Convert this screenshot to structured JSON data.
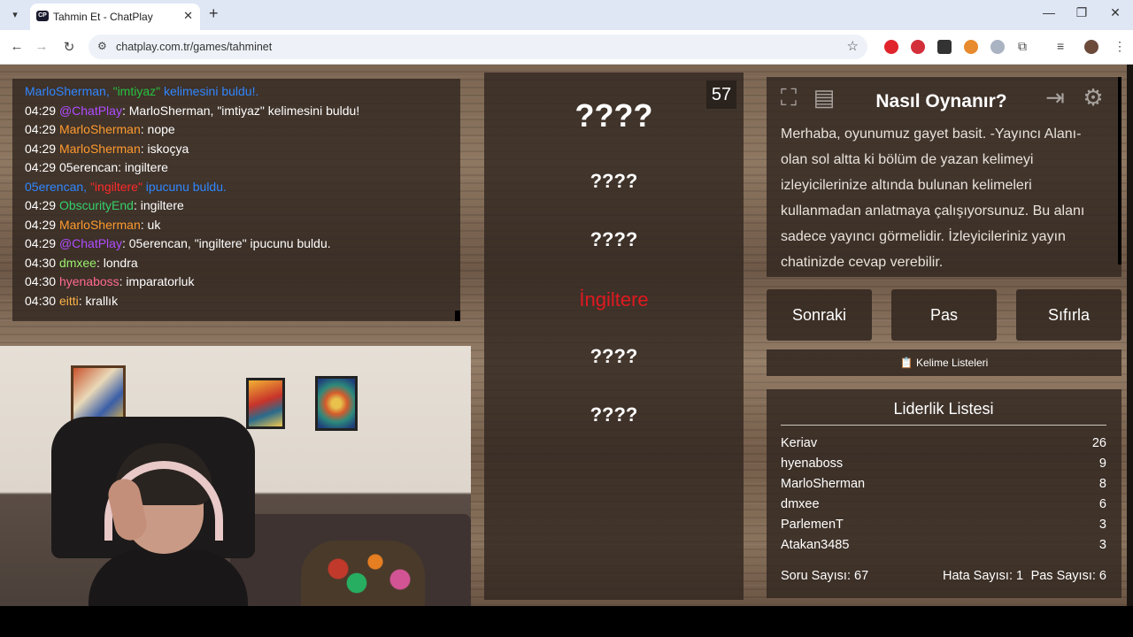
{
  "browser": {
    "tab_title": "Tahmin Et - ChatPlay",
    "url": "chatplay.com.tr/games/tahminet"
  },
  "chat": {
    "lines": [
      {
        "type": "sys",
        "text": "MarloSherman, \"imtiyaz\" kelimesini buldu!."
      },
      {
        "time": "04:29",
        "user": "@ChatPlay",
        "msg": ": MarloSherman, \"imtiyaz\" kelimesini buldu!"
      },
      {
        "time": "04:29",
        "user": "MarloSherman",
        "msg": ": nope"
      },
      {
        "time": "04:29",
        "user": "MarloSherman",
        "msg": ": iskoçya"
      },
      {
        "time": "04:29",
        "user": "05erencan",
        "msg": ": ingiltere"
      },
      {
        "type": "sys",
        "text": "05erencan, \"ingiltere\" ipucunu buldu."
      },
      {
        "time": "04:29",
        "user": "ObscurityEnd",
        "msg": ": ingiltere"
      },
      {
        "time": "04:29",
        "user": "MarloSherman",
        "msg": ": uk"
      },
      {
        "time": "04:29",
        "user": "@ChatPlay",
        "msg": ": 05erencan, \"ingiltere\" ipucunu buldu."
      },
      {
        "time": "04:30",
        "user": "dmxee",
        "msg": ": londra"
      },
      {
        "time": "04:30",
        "user": "hyenaboss",
        "msg": ": imparatorluk"
      },
      {
        "time": "04:30",
        "user": "eitti",
        "msg": ": krallık"
      }
    ]
  },
  "words": {
    "timer": "57",
    "main": "????",
    "hints": [
      "????",
      "????",
      "İngiltere",
      "????",
      "????"
    ]
  },
  "howto": {
    "title": "Nasıl Oynanır?",
    "text": "Merhaba, oyunumuz gayet basit. -Yayıncı Alanı- olan sol altta ki bölüm de yazan kelimeyi izleyicilerinize altında bulunan kelimeleri kullanmadan anlatmaya çalışıyorsunuz. Bu alanı sadece yayıncı görmelidir. İzleyicileriniz yayın chatinizde cevap verebilir."
  },
  "buttons": {
    "next": "Sonraki",
    "pass": "Pas",
    "reset": "Sıfırla",
    "word_lists": "📋 Kelime Listeleri"
  },
  "leaderboard": {
    "title": "Liderlik Listesi",
    "entries": [
      {
        "name": "Keriav",
        "score": "26"
      },
      {
        "name": "hyenaboss",
        "score": "9"
      },
      {
        "name": "MarloSherman",
        "score": "8"
      },
      {
        "name": "dmxee",
        "score": "6"
      },
      {
        "name": "ParlemenT",
        "score": "3"
      },
      {
        "name": "Atakan3485",
        "score": "3"
      }
    ],
    "question_count": "Soru Sayısı: 67",
    "error_count": "Hata Sayısı: 1",
    "pass_count": "Pas Sayısı: 6"
  }
}
